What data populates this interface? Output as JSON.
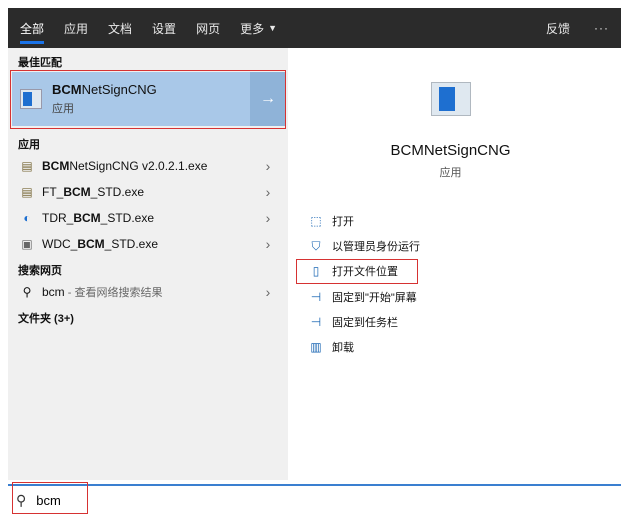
{
  "tabs": [
    {
      "label": "全部",
      "active": true
    },
    {
      "label": "应用"
    },
    {
      "label": "文档"
    },
    {
      "label": "设置"
    },
    {
      "label": "网页"
    },
    {
      "label": "更多"
    }
  ],
  "top_right": {
    "feedback": "反馈",
    "more": "···"
  },
  "left": {
    "best_match_heading": "最佳匹配",
    "best_match": {
      "name_bold": "BCM",
      "name_rest": "NetSignCNG",
      "type": "应用",
      "arrow": "→"
    },
    "apps_heading": "应用",
    "apps": [
      {
        "pre": "",
        "bold": "BCM",
        "post": "NetSignCNG v2.0.2.1.exe",
        "chev": "›"
      },
      {
        "pre": "FT_",
        "bold": "BCM",
        "post": "_STD.exe",
        "chev": "›"
      },
      {
        "pre": "TDR_",
        "bold": "BCM",
        "post": "_STD.exe",
        "chev": "›"
      },
      {
        "pre": "WDC_",
        "bold": "BCM",
        "post": "_STD.exe",
        "chev": "›"
      }
    ],
    "web_heading": "搜索网页",
    "web": {
      "query": "bcm",
      "suffix": " - 查看网络搜索结果",
      "chev": "›"
    },
    "folders_heading": "文件夹 (3+)"
  },
  "right": {
    "title": "BCMNetSignCNG",
    "subtitle": "应用",
    "actions": [
      {
        "label": "打开",
        "icon": "open-icon"
      },
      {
        "label": "以管理员身份运行",
        "icon": "shield-icon"
      },
      {
        "label": "打开文件位置",
        "icon": "file-location-icon"
      },
      {
        "label": "固定到\"开始\"屏幕",
        "icon": "pin-icon"
      },
      {
        "label": "固定到任务栏",
        "icon": "pin-icon"
      },
      {
        "label": "卸载",
        "icon": "trash-icon"
      }
    ]
  },
  "search": {
    "value": "bcm"
  },
  "colors": {
    "accent": "#1a73e8",
    "selection": "#a9c8e8",
    "highlight_box": "#d63232"
  }
}
